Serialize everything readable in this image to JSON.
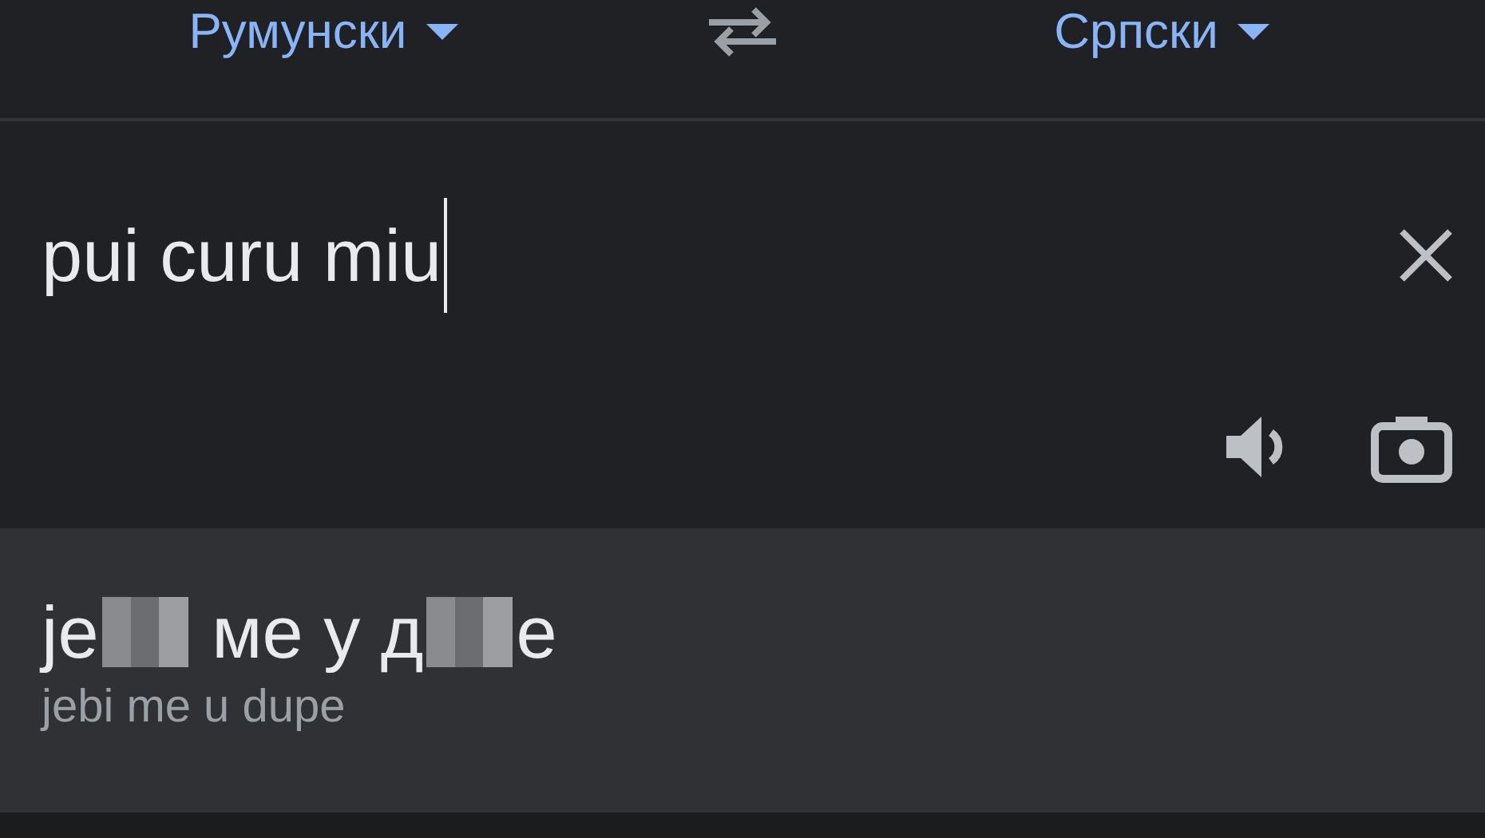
{
  "language_bar": {
    "source_language": "Румунски",
    "target_language": "Српски"
  },
  "input": {
    "value": "pui curu miu",
    "focused": true
  },
  "result": {
    "parts": [
      {
        "kind": "text",
        "text": "je"
      },
      {
        "kind": "censored"
      },
      {
        "kind": "text",
        "text": " ме у д"
      },
      {
        "kind": "censored"
      },
      {
        "kind": "text",
        "text": "е"
      }
    ],
    "romanization": "jebi me u dupe"
  }
}
